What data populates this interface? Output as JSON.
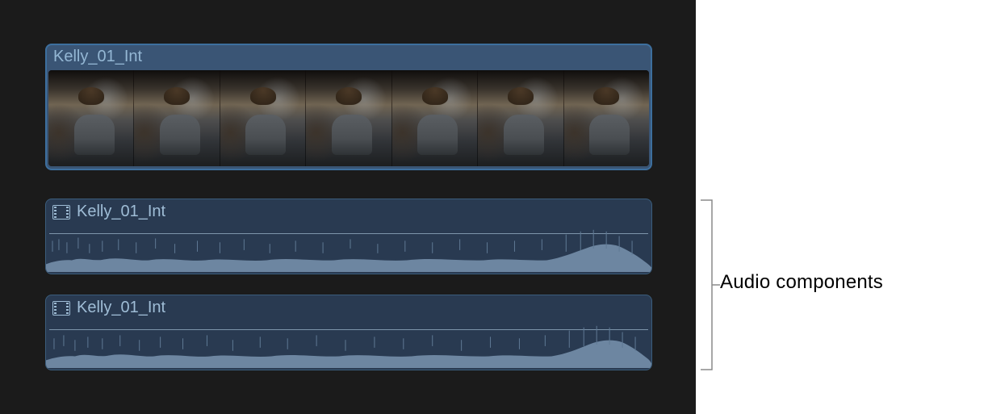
{
  "timeline": {
    "video_clip": {
      "label": "Kelly_01_Int"
    },
    "audio_clips": [
      {
        "label": "Kelly_01_Int"
      },
      {
        "label": "Kelly_01_Int"
      }
    ]
  },
  "annotation": {
    "label": "Audio components"
  }
}
